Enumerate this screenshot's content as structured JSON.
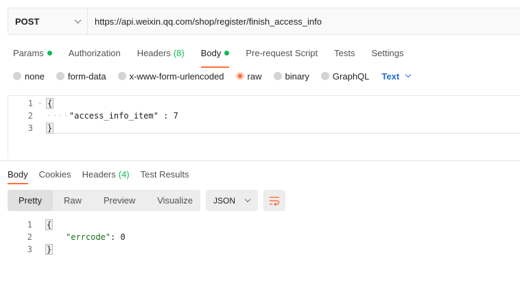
{
  "request": {
    "method": "POST",
    "url": "https://api.weixin.qq.com/shop/register/finish_access_info"
  },
  "request_tabs": [
    {
      "label": "Params",
      "indicator": "dot"
    },
    {
      "label": "Authorization"
    },
    {
      "label": "Headers",
      "count": "(8)"
    },
    {
      "label": "Body",
      "indicator": "dot",
      "active": true
    },
    {
      "label": "Pre-request Script"
    },
    {
      "label": "Tests"
    },
    {
      "label": "Settings"
    }
  ],
  "body_types": [
    {
      "label": "none"
    },
    {
      "label": "form-data"
    },
    {
      "label": "x-www-form-urlencoded"
    },
    {
      "label": "raw",
      "selected": true
    },
    {
      "label": "binary"
    },
    {
      "label": "GraphQL"
    }
  ],
  "body_format": "Text",
  "request_body": {
    "line_numbers": [
      "1",
      "2",
      "3"
    ],
    "open_brace": "{",
    "close_brace": "}",
    "key": "\"access_info_item\"",
    "separator": " : ",
    "value": "7"
  },
  "response_tabs": [
    {
      "label": "Body",
      "active": true
    },
    {
      "label": "Cookies"
    },
    {
      "label": "Headers",
      "count": "(4)"
    },
    {
      "label": "Test Results"
    }
  ],
  "response_views": [
    "Pretty",
    "Raw",
    "Preview",
    "Visualize"
  ],
  "response_format": "JSON",
  "response_body": {
    "line_numbers": [
      "1",
      "2",
      "3"
    ],
    "open_brace": "{",
    "close_brace": "}",
    "key": "\"errcode\"",
    "separator": ": ",
    "value": "0"
  },
  "colors": {
    "accent": "#ff6c37",
    "status_green": "#0cbb52",
    "link_blue": "#1f6bd6"
  },
  "icons": [
    "chevron-down-icon",
    "wrap-lines-icon"
  ]
}
